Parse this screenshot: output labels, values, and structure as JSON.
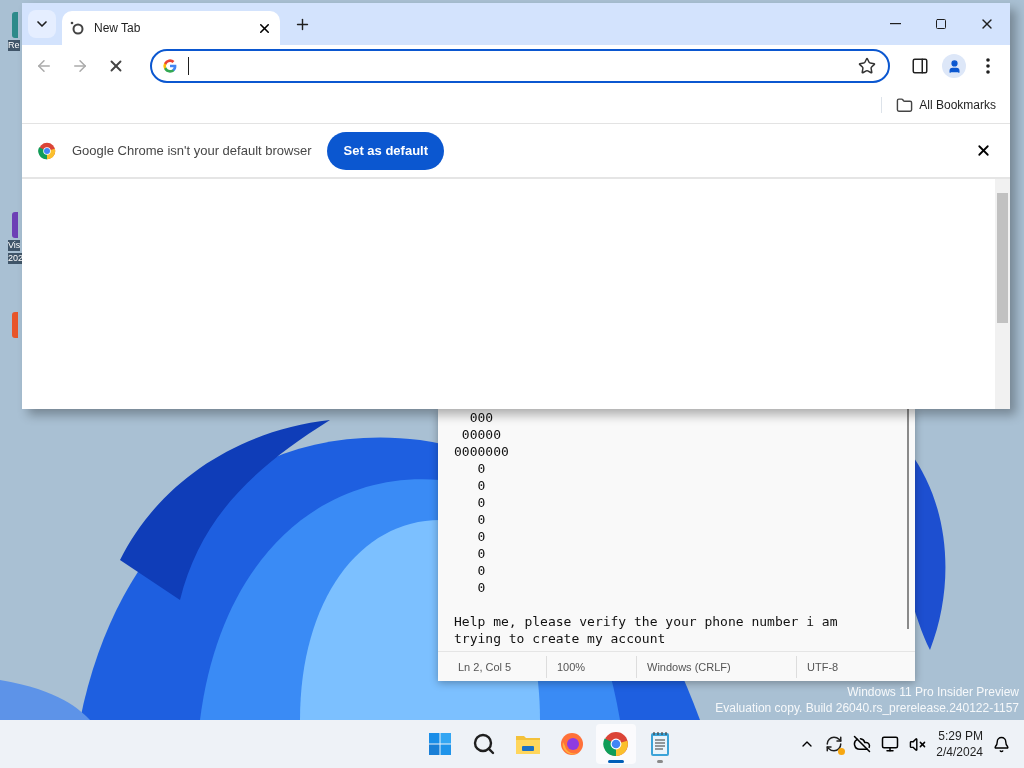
{
  "desktop": {
    "icons": [
      {
        "color": "#2d8a8a",
        "lines": [
          "Re"
        ]
      },
      {
        "color": "#6d3fb5",
        "lines": [
          "Vis",
          "202"
        ]
      },
      {
        "color": "#e8552a"
      }
    ]
  },
  "browser": {
    "tabs": [
      {
        "title": "New Tab",
        "selected": true
      }
    ],
    "bookmarks": [
      "All Bookmarks"
    ],
    "infobar": {
      "message": "Google Chrome isn't your default browser",
      "button": "Set as default"
    }
  },
  "notepad": {
    "blocks": [
      [
        "  000",
        " 00000",
        "0000000",
        "   0",
        "   0",
        "   0",
        "   0",
        "   0",
        "   0",
        "   0",
        "   0"
      ],
      [
        "Help me, please verify the your phone number i am",
        "trying to create my account"
      ]
    ],
    "status": [
      "Ln 2, Col 5",
      "100%",
      "Windows (CRLF)",
      "UTF-8"
    ]
  },
  "watermark": [
    "Windows 11 Pro Insider Preview",
    "Evaluation copy. Build 26040.rs_prerelease.240122-1157"
  ],
  "taskbar": {
    "apps": [
      {
        "kind": "start",
        "selected": false,
        "running": false
      },
      {
        "kind": "search",
        "selected": false,
        "running": false
      },
      {
        "kind": "files",
        "selected": false,
        "running": false
      },
      {
        "kind": "firefox",
        "selected": false,
        "running": false
      },
      {
        "kind": "chrome",
        "selected": true,
        "running": true
      },
      {
        "kind": "notepad",
        "selected": false,
        "running": true
      }
    ],
    "clock": {
      "time": "5:29 PM",
      "date": "2/4/2024"
    }
  }
}
